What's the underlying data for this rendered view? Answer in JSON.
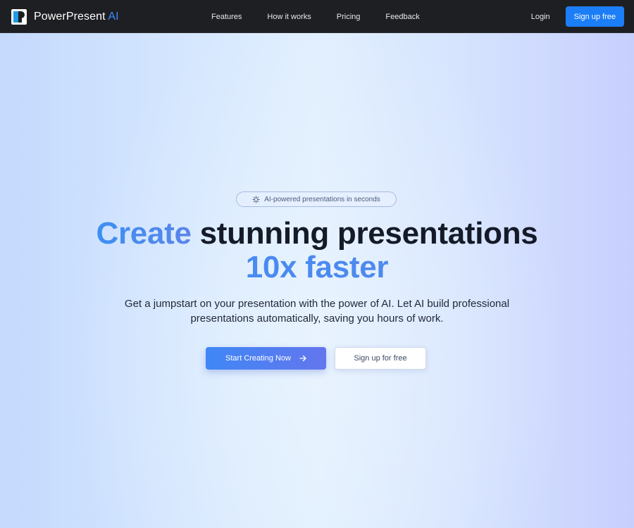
{
  "nav": {
    "brand": {
      "name": "PowerPresent",
      "accent": "AI"
    },
    "links": [
      {
        "label": "Features"
      },
      {
        "label": "How it works"
      },
      {
        "label": "Pricing"
      },
      {
        "label": "Feedback"
      }
    ],
    "login_label": "Login",
    "signup_label": "Sign up free"
  },
  "hero": {
    "badge": {
      "icon": "sparkle-icon",
      "text": "AI-powered presentations in seconds"
    },
    "headline": {
      "highlight": "Create",
      "rest": "stunning presentations",
      "line2": "10x faster"
    },
    "subtext": {
      "line1": "Get a jumpstart on your presentation with the power of AI. Let AI build professional",
      "line2": "presentations automatically, saving you hours of work."
    },
    "primary_cta": {
      "label": "Start Creating Now",
      "icon": "arrow-right-icon"
    },
    "secondary_cta": {
      "label": "Sign up for free"
    }
  },
  "colors": {
    "nav_bg": "#1e1f22",
    "accent": "#1c7ef6",
    "brand_accent": "#3c8dff",
    "headline_dark": "#141a28",
    "gradient_start": "#3f87f5",
    "gradient_end": "#6476ee"
  }
}
